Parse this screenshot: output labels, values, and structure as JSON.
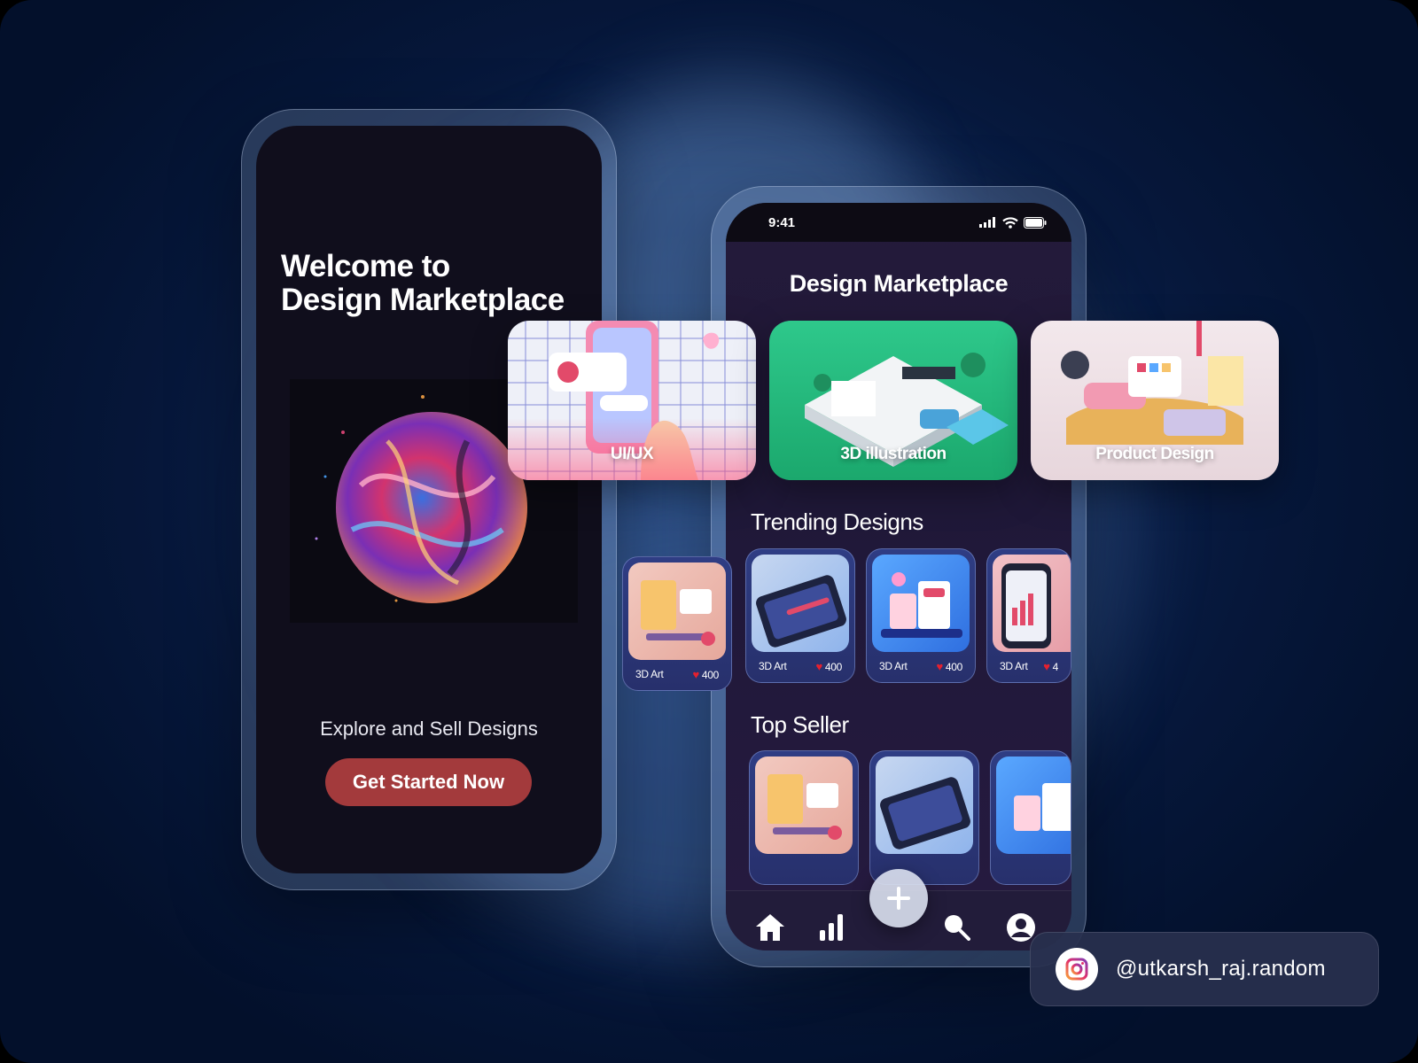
{
  "welcome_screen": {
    "title": "Welcome to\nDesign Marketplace",
    "subtitle": "Explore and Sell Designs",
    "cta_label": "Get Started Now"
  },
  "home_screen": {
    "status_time": "9:41",
    "title": "Design Marketplace",
    "categories": [
      {
        "label": "UI/UX"
      },
      {
        "label": "3D illustration"
      },
      {
        "label": "Product Design"
      }
    ],
    "trending": {
      "title": "Trending Designs",
      "items": [
        {
          "tag": "3D Art",
          "likes": "400"
        },
        {
          "tag": "3D Art",
          "likes": "400"
        },
        {
          "tag": "3D Art",
          "likes": "400"
        },
        {
          "tag": "3D Art",
          "likes": "4"
        }
      ]
    },
    "top_seller": {
      "title": "Top Seller"
    },
    "nav": [
      "home-icon",
      "stats-icon",
      "add-icon",
      "search-icon",
      "profile-icon"
    ]
  },
  "social": {
    "handle": "@utkarsh_raj.random",
    "icon": "instagram-icon"
  },
  "colors": {
    "accent_cta": "#a33a3c",
    "card_bg": "#2f3d84",
    "green_category": "#2ec88b",
    "heart": "#e5202e"
  }
}
